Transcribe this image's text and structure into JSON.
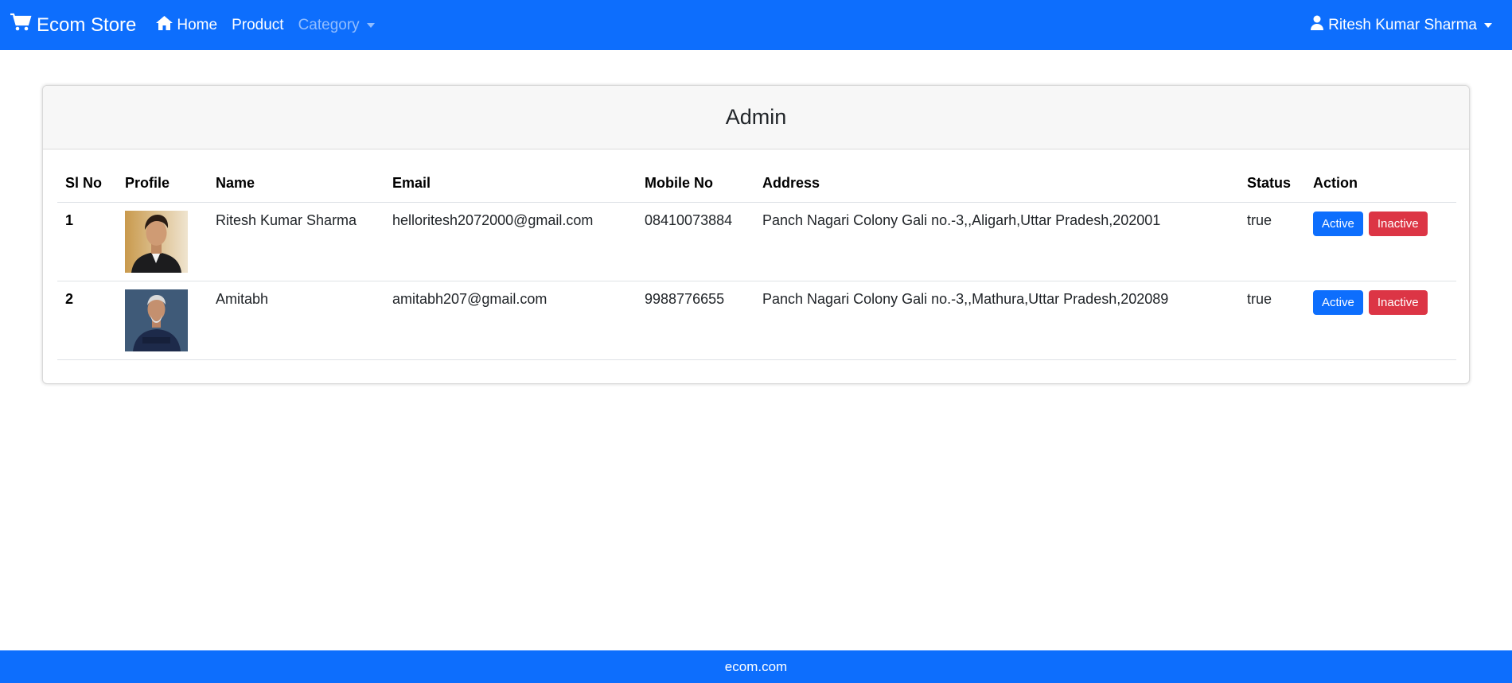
{
  "navbar": {
    "brand": "Ecom Store",
    "links": {
      "home": "Home",
      "product": "Product",
      "category": "Category"
    },
    "user": "Ritesh Kumar Sharma",
    "color": "#0d6efd"
  },
  "card": {
    "title": "Admin"
  },
  "table": {
    "headers": [
      "Sl No",
      "Profile",
      "Name",
      "Email",
      "Mobile No",
      "Address",
      "Status",
      "Action"
    ],
    "rows": [
      {
        "sl_no": "1",
        "profile": "man-dark-jacket-portrait",
        "name": "Ritesh Kumar Sharma",
        "email": "helloritesh2072000@gmail.com",
        "mobile": "08410073884",
        "address": "Panch Nagari Colony Gali no.-3,,Aligarh,Uttar Pradesh,202001",
        "status": "true",
        "active_label": "Active",
        "inactive_label": "Inactive"
      },
      {
        "sl_no": "2",
        "profile": "man-navy-suit-portrait",
        "name": "Amitabh",
        "email": "amitabh207@gmail.com",
        "mobile": "9988776655",
        "address": "Panch Nagari Colony Gali no.-3,,Mathura,Uttar Pradesh,202089",
        "status": "true",
        "active_label": "Active",
        "inactive_label": "Inactive"
      }
    ]
  },
  "footer": {
    "text": "ecom.com"
  }
}
